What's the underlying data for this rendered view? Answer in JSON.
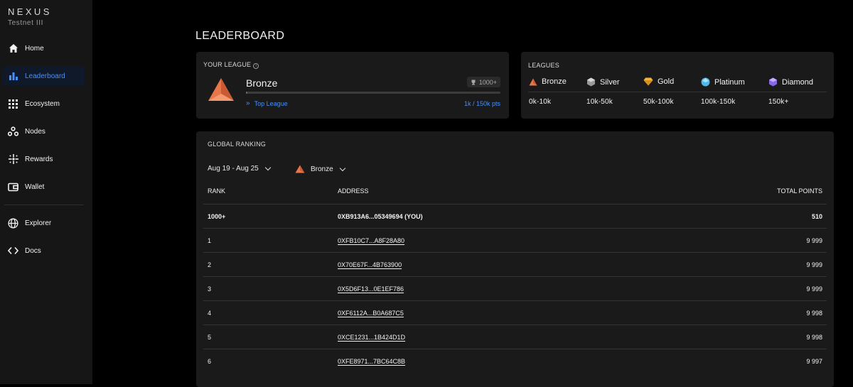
{
  "brand": {
    "name": "NEXUS",
    "subtitle": "Testnet III"
  },
  "sidebar": {
    "items": [
      {
        "label": "Home",
        "icon": "home-icon"
      },
      {
        "label": "Leaderboard",
        "icon": "bar-chart-icon",
        "active": true
      },
      {
        "label": "Ecosystem",
        "icon": "grid-icon"
      },
      {
        "label": "Nodes",
        "icon": "nodes-icon"
      },
      {
        "label": "Rewards",
        "icon": "sparkle-icon"
      },
      {
        "label": "Wallet",
        "icon": "wallet-icon"
      }
    ],
    "bottom_items": [
      {
        "label": "Explorer",
        "icon": "globe-icon"
      },
      {
        "label": "Docs",
        "icon": "code-icon"
      }
    ]
  },
  "page": {
    "title": "LEADERBOARD"
  },
  "your_league": {
    "label": "YOUR LEAGUE",
    "league": "Bronze",
    "rank_badge": "1000+",
    "progress_fraction": 0.0067,
    "top_league_link": "Top League",
    "points": "1k / 150k pts"
  },
  "leagues": {
    "label": "LEAGUES",
    "items": [
      {
        "name": "Bronze",
        "range": "0k-10k",
        "color": "#e8764a",
        "icon": "bronze-triangle-icon"
      },
      {
        "name": "Silver",
        "range": "10k-50k",
        "color": "#b8b8b8",
        "icon": "silver-gem-icon"
      },
      {
        "name": "Gold",
        "range": "50k-100k",
        "color": "#f0b53a",
        "icon": "gold-gem-icon"
      },
      {
        "name": "Platinum",
        "range": "100k-150k",
        "color": "#4fb8e8",
        "icon": "platinum-gem-icon"
      },
      {
        "name": "Diamond",
        "range": "150k+",
        "color": "#9a78f0",
        "icon": "diamond-gem-icon"
      }
    ]
  },
  "ranking": {
    "label": "GLOBAL RANKING",
    "date_filter": "Aug 19 - Aug 25",
    "league_filter": "Bronze",
    "columns": {
      "rank": "RANK",
      "address": "ADDRESS",
      "points": "TOTAL POINTS"
    },
    "rows": [
      {
        "rank": "1000+",
        "address": "0XB913A6...05349694 (YOU)",
        "points": "510",
        "you": true
      },
      {
        "rank": "1",
        "address": "0XFB10C7...A8F28A80",
        "points": "9 999"
      },
      {
        "rank": "2",
        "address": "0X70E67F...4B763900",
        "points": "9 999"
      },
      {
        "rank": "3",
        "address": "0X5D6F13...0E1EF786",
        "points": "9 999"
      },
      {
        "rank": "4",
        "address": "0XF6112A...B0A687C5",
        "points": "9 998"
      },
      {
        "rank": "5",
        "address": "0XCE1231...1B424D1D",
        "points": "9 998"
      },
      {
        "rank": "6",
        "address": "0XFE8971...7BC64C8B",
        "points": "9 997"
      }
    ]
  },
  "colors": {
    "accent": "#4a8ff5",
    "bronze": "#e8764a",
    "background": "#000000",
    "card": "#1a1a1a",
    "sidebar": "#161616"
  }
}
